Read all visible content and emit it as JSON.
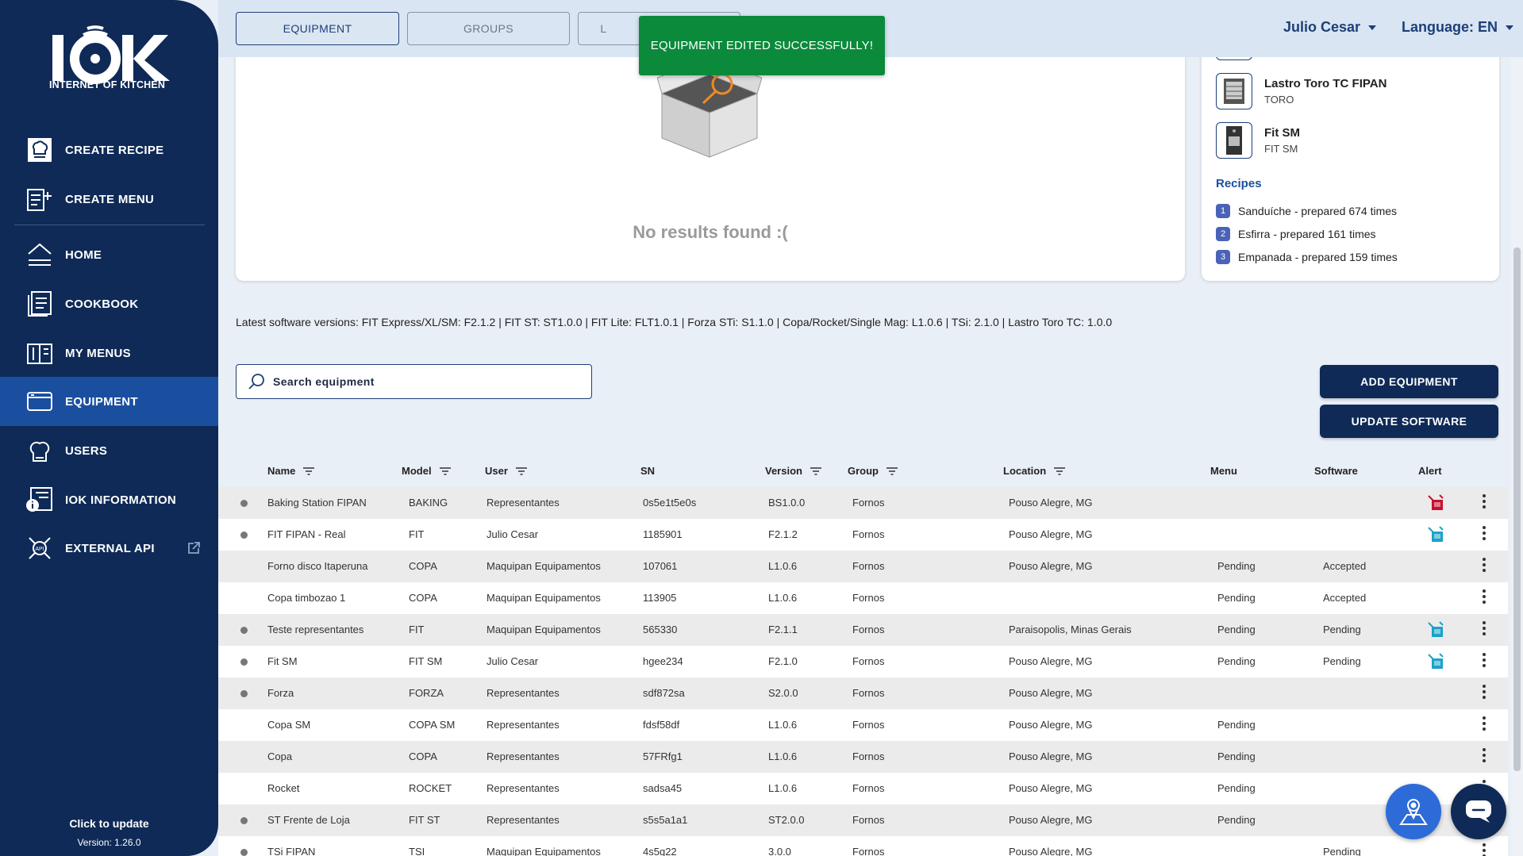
{
  "brand": {
    "logo_text": "IOK",
    "tagline": "INTERNET OF KITCHEN"
  },
  "sidebar": {
    "items": [
      {
        "label": "CREATE RECIPE",
        "icon": "chef-hat-icon"
      },
      {
        "label": "CREATE MENU",
        "icon": "menu-add-icon"
      },
      {
        "label": "HOME",
        "icon": "home-icon"
      },
      {
        "label": "COOKBOOK",
        "icon": "cookbook-icon"
      },
      {
        "label": "MY MENUS",
        "icon": "book-icon"
      },
      {
        "label": "EQUIPMENT",
        "icon": "equipment-icon",
        "active": true
      },
      {
        "label": "USERS",
        "icon": "users-icon"
      },
      {
        "label": "IOK INFORMATION",
        "icon": "info-icon"
      },
      {
        "label": "EXTERNAL API",
        "icon": "api-icon"
      }
    ],
    "update_text": "Click to update",
    "version": "Version: 1.26.0"
  },
  "topbar": {
    "tabs": [
      "EQUIPMENT",
      "GROUPS",
      "L"
    ],
    "user": "Julio Cesar",
    "language": "Language: EN"
  },
  "toast": "EQUIPMENT EDITED SUCCESSFULLY!",
  "no_results": "No results found :(",
  "side_card": {
    "equipment": [
      {
        "name": "Lastro Toro TC FIPAN",
        "model": "TORO"
      },
      {
        "name": "Fit SM",
        "model": "FIT SM"
      }
    ],
    "recipes_title": "Recipes",
    "recipes": [
      {
        "num": "1",
        "text": "Sanduíche - prepared 674 times"
      },
      {
        "num": "2",
        "text": "Esfirra - prepared 161 times"
      },
      {
        "num": "3",
        "text": "Empanada - prepared 159 times"
      }
    ]
  },
  "software_versions": "Latest software versions: FIT Express/XL/SM: F2.1.2 | FIT ST: ST1.0.0 | FIT Lite: FLT1.0.1 | Forza STi: S1.1.0 | Copa/Rocket/Single Mag: L1.0.6 | TSi: 2.1.0 | Lastro Toro TC: 1.0.0",
  "search": {
    "placeholder": "Search equipment"
  },
  "buttons": {
    "add": "ADD EQUIPMENT",
    "update": "UPDATE SOFTWARE"
  },
  "table": {
    "headers": {
      "name": "Name",
      "model": "Model",
      "user": "User",
      "sn": "SN",
      "version": "Version",
      "group": "Group",
      "location": "Location",
      "menu": "Menu",
      "software": "Software",
      "alert": "Alert"
    },
    "rows": [
      {
        "status_dot": true,
        "name": "Baking Station FIPAN",
        "model": "BAKING",
        "user": "Representantes",
        "sn": "0s5e1t5e0s",
        "version": "BS1.0.0",
        "group": "Fornos",
        "location": "Pouso Alegre, MG",
        "menu": "",
        "software": "",
        "alert": "alert-red"
      },
      {
        "status_dot": true,
        "name": "FIT FIPAN - Real",
        "model": "FIT",
        "user": "Julio Cesar",
        "sn": "1185901",
        "version": "F2.1.2",
        "group": "Fornos",
        "location": "Pouso Alegre, MG",
        "menu": "",
        "software": "",
        "alert": "alert-blue"
      },
      {
        "status_dot": false,
        "name": "Forno disco Itaperuna",
        "model": "COPA",
        "user": "Maquipan Equipamentos",
        "sn": "107061",
        "version": "L1.0.6",
        "group": "Fornos",
        "location": "Pouso Alegre, MG",
        "menu": "Pending",
        "software": "Accepted",
        "alert": ""
      },
      {
        "status_dot": false,
        "name": "Copa timbozao 1",
        "model": "COPA",
        "user": "Maquipan Equipamentos",
        "sn": "113905",
        "version": "L1.0.6",
        "group": "Fornos",
        "location": "",
        "menu": "Pending",
        "software": "Accepted",
        "alert": ""
      },
      {
        "status_dot": true,
        "name": "Teste representantes",
        "model": "FIT",
        "user": "Maquipan Equipamentos",
        "sn": "565330",
        "version": "F2.1.1",
        "group": "Fornos",
        "location": "Paraisopolis, Minas Gerais",
        "menu": "Pending",
        "software": "Pending",
        "alert": "alert-blue"
      },
      {
        "status_dot": true,
        "name": "Fit SM",
        "model": "FIT SM",
        "user": "Julio Cesar",
        "sn": "hgee234",
        "version": "F2.1.0",
        "group": "Fornos",
        "location": "Pouso Alegre, MG",
        "menu": "Pending",
        "software": "Pending",
        "alert": "alert-blue"
      },
      {
        "status_dot": true,
        "name": "Forza",
        "model": "FORZA",
        "user": "Representantes",
        "sn": "sdf872sa",
        "version": "S2.0.0",
        "group": "Fornos",
        "location": "Pouso Alegre, MG",
        "menu": "",
        "software": "",
        "alert": ""
      },
      {
        "status_dot": false,
        "name": "Copa SM",
        "model": "COPA SM",
        "user": "Representantes",
        "sn": "fdsf58df",
        "version": "L1.0.6",
        "group": "Fornos",
        "location": "Pouso Alegre, MG",
        "menu": "Pending",
        "software": "",
        "alert": ""
      },
      {
        "status_dot": false,
        "name": "Copa",
        "model": "COPA",
        "user": "Representantes",
        "sn": "57FRfg1",
        "version": "L1.0.6",
        "group": "Fornos",
        "location": "Pouso Alegre, MG",
        "menu": "Pending",
        "software": "",
        "alert": ""
      },
      {
        "status_dot": false,
        "name": "Rocket",
        "model": "ROCKET",
        "user": "Representantes",
        "sn": "sadsa45",
        "version": "L1.0.6",
        "group": "Fornos",
        "location": "Pouso Alegre, MG",
        "menu": "Pending",
        "software": "",
        "alert": ""
      },
      {
        "status_dot": true,
        "name": "ST Frente de Loja",
        "model": "FIT ST",
        "user": "Representantes",
        "sn": "s5s5a1a1",
        "version": "ST2.0.0",
        "group": "Fornos",
        "location": "Pouso Alegre, MG",
        "menu": "Pending",
        "software": "",
        "alert": ""
      },
      {
        "status_dot": true,
        "name": "TSi FIPAN",
        "model": "TSI",
        "user": "Maquipan Equipamentos",
        "sn": "4s5q22",
        "version": "3.0.0",
        "group": "Fornos",
        "location": "Pouso Alegre, MG",
        "menu": "",
        "software": "Pending",
        "alert": ""
      }
    ]
  },
  "colors": {
    "sidebar": "#0f2a57",
    "active": "#1a4fa0",
    "toast": "#0b8a3c",
    "alert_red": "#c8102e",
    "alert_blue": "#1aa3c9"
  }
}
